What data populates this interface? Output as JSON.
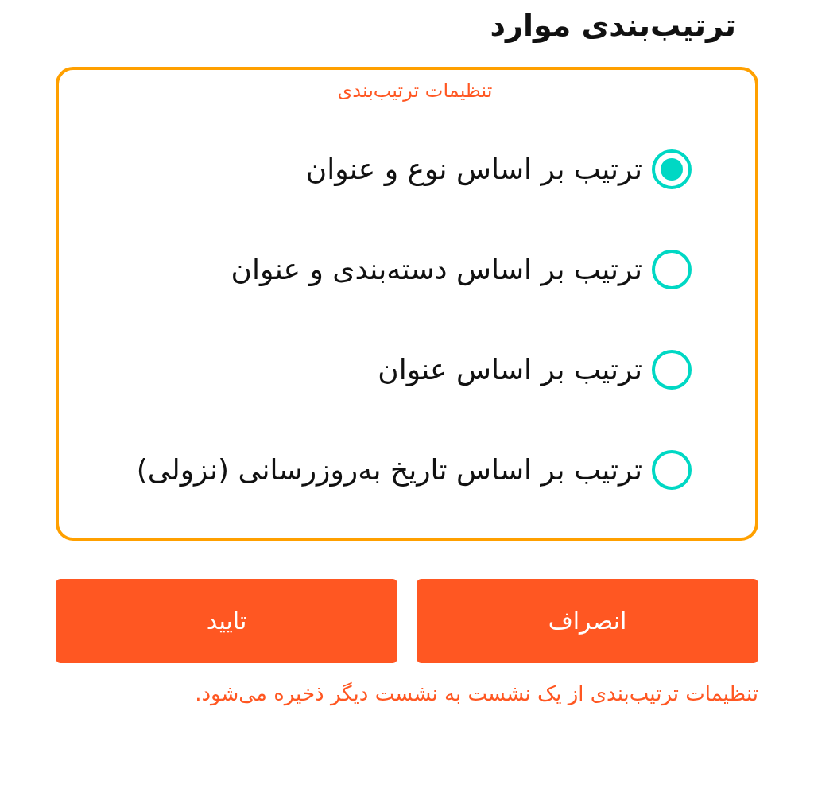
{
  "title": "ترتیب‌بندی موارد",
  "sort_settings": {
    "legend": "تنظیمات ترتیب‌بندی",
    "options": [
      {
        "label": "ترتیب بر اساس نوع و عنوان",
        "selected": true
      },
      {
        "label": "ترتیب بر اساس دسته‌بندی و عنوان",
        "selected": false
      },
      {
        "label": "ترتیب بر اساس عنوان",
        "selected": false
      },
      {
        "label": "ترتیب بر اساس تاریخ به‌روزرسانی (نزولی)",
        "selected": false
      }
    ]
  },
  "buttons": [
    {
      "label": "انصراف"
    },
    {
      "label": "تایید"
    }
  ],
  "note": "تنظیمات ترتیب‌بندی از یک نشست به نشست دیگر ذخیره می‌شود."
}
